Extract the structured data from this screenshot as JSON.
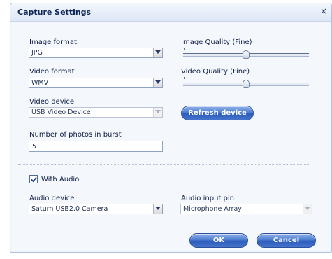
{
  "window": {
    "title": "Capture Settings",
    "close_glyph": "×"
  },
  "image_format": {
    "label": "Image format",
    "value": "JPG"
  },
  "video_format": {
    "label": "Video format",
    "value": "WMV"
  },
  "video_device": {
    "label": "Video device",
    "value": "USB Video Device"
  },
  "burst": {
    "label": "Number of photos in burst",
    "value": "5"
  },
  "image_quality": {
    "label": "Image Quality (Fine)",
    "level": 0.5
  },
  "video_quality": {
    "label": "Video Quality (Fine)",
    "level": 0.5
  },
  "refresh_button": "Refresh device",
  "audio": {
    "with_audio_label": "With Audio",
    "with_audio_checked": true,
    "device_label": "Audio device",
    "device_value": "Saturn USB2.0 Camera",
    "input_pin_label": "Audio input pin",
    "input_pin_value": "Microphone Array"
  },
  "buttons": {
    "ok": "OK",
    "cancel": "Cancel"
  },
  "colors": {
    "accent": "#3f6fcb",
    "title_text": "#0d2459"
  }
}
